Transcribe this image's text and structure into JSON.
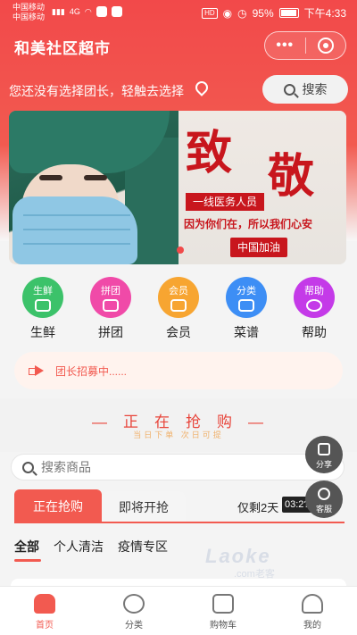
{
  "status_bar": {
    "carrier_1": "中国移动",
    "carrier_2": "中国移动",
    "network": "4G",
    "hd": "HD",
    "battery": "95%",
    "time": "下午4:33"
  },
  "header": {
    "title": "和美社区超市",
    "more_label": "•••"
  },
  "leader": {
    "prompt": "您还没有选择团长，轻触去选择",
    "search_label": "搜索"
  },
  "banner": {
    "headline_1": "致",
    "headline_2": "敬",
    "frontline": "一线医务人员",
    "slogan": "因为你们在，所以我们心安",
    "cheer": "中国加油"
  },
  "categories": [
    {
      "badge": "生鲜",
      "label": "生鲜",
      "color": "#3cc26a"
    },
    {
      "badge": "拼团",
      "label": "拼团",
      "color": "#f04aa8"
    },
    {
      "badge": "会员",
      "label": "会员",
      "color": "#f7a531"
    },
    {
      "badge": "分类",
      "label": "菜谱",
      "color": "#3d8ef5"
    },
    {
      "badge": "帮助",
      "label": "帮助",
      "color": "#c43ae8"
    }
  ],
  "notice": {
    "text": "团长招募中......"
  },
  "flash": {
    "title_chars": [
      "正",
      "在",
      "抢",
      "购"
    ],
    "subtitle": "当日下单  次日可提"
  },
  "goods_search": {
    "placeholder": "搜索商品"
  },
  "sale_tabs": {
    "active": "正在抢购",
    "upcoming": "即将开抢",
    "remaining": "仅剩2天",
    "clock": "03:2?:20"
  },
  "filters": [
    "全部",
    "个人清洁",
    "疫情专区"
  ],
  "watermark": {
    "logo": "Laoke",
    "sub": ".com老客"
  },
  "float_buttons": {
    "share": "分享",
    "service": "客服"
  },
  "tabbar": [
    {
      "label": "首页",
      "icon": "home-icon",
      "active": true
    },
    {
      "label": "分类",
      "icon": "category-icon",
      "active": false
    },
    {
      "label": "购物车",
      "icon": "cart-icon",
      "active": false
    },
    {
      "label": "我的",
      "icon": "profile-icon",
      "active": false
    }
  ],
  "colors": {
    "brand_red": "#f25a50",
    "banner_red": "#c8161d"
  }
}
